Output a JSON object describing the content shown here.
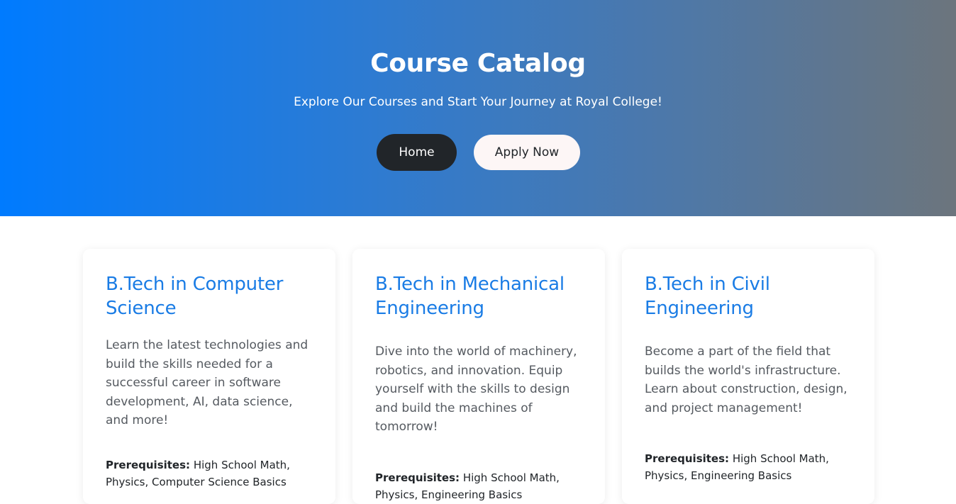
{
  "hero": {
    "title": "Course Catalog",
    "subtitle": "Explore Our Courses and Start Your Journey at Royal College!",
    "buttons": {
      "home": "Home",
      "apply": "Apply Now"
    }
  },
  "courses": [
    {
      "title": "B.Tech in Computer Science",
      "description": "Learn the latest technologies and build the skills needed for a successful career in software development, AI, data science, and more!",
      "prereq_label": "Prerequisites:",
      "prereq_value": "High School Math, Physics, Computer Science Basics"
    },
    {
      "title": "B.Tech in Mechanical Engineering",
      "description": "Dive into the world of machinery, robotics, and innovation. Equip yourself with the skills to design and build the machines of tomorrow!",
      "prereq_label": "Prerequisites:",
      "prereq_value": "High School Math, Physics, Engineering Basics"
    },
    {
      "title": "B.Tech in Civil Engineering",
      "description": "Become a part of the field that builds the world's infrastructure. Learn about construction, design, and project management!",
      "prereq_label": "Prerequisites:",
      "prereq_value": "High School Math, Physics, Engineering Basics"
    }
  ],
  "colors": {
    "gradient_start": "#007bff",
    "gradient_end": "#6c757d",
    "accent": "#1a7ce5",
    "home_button": "#212529",
    "apply_button": "#fdf6f6"
  }
}
